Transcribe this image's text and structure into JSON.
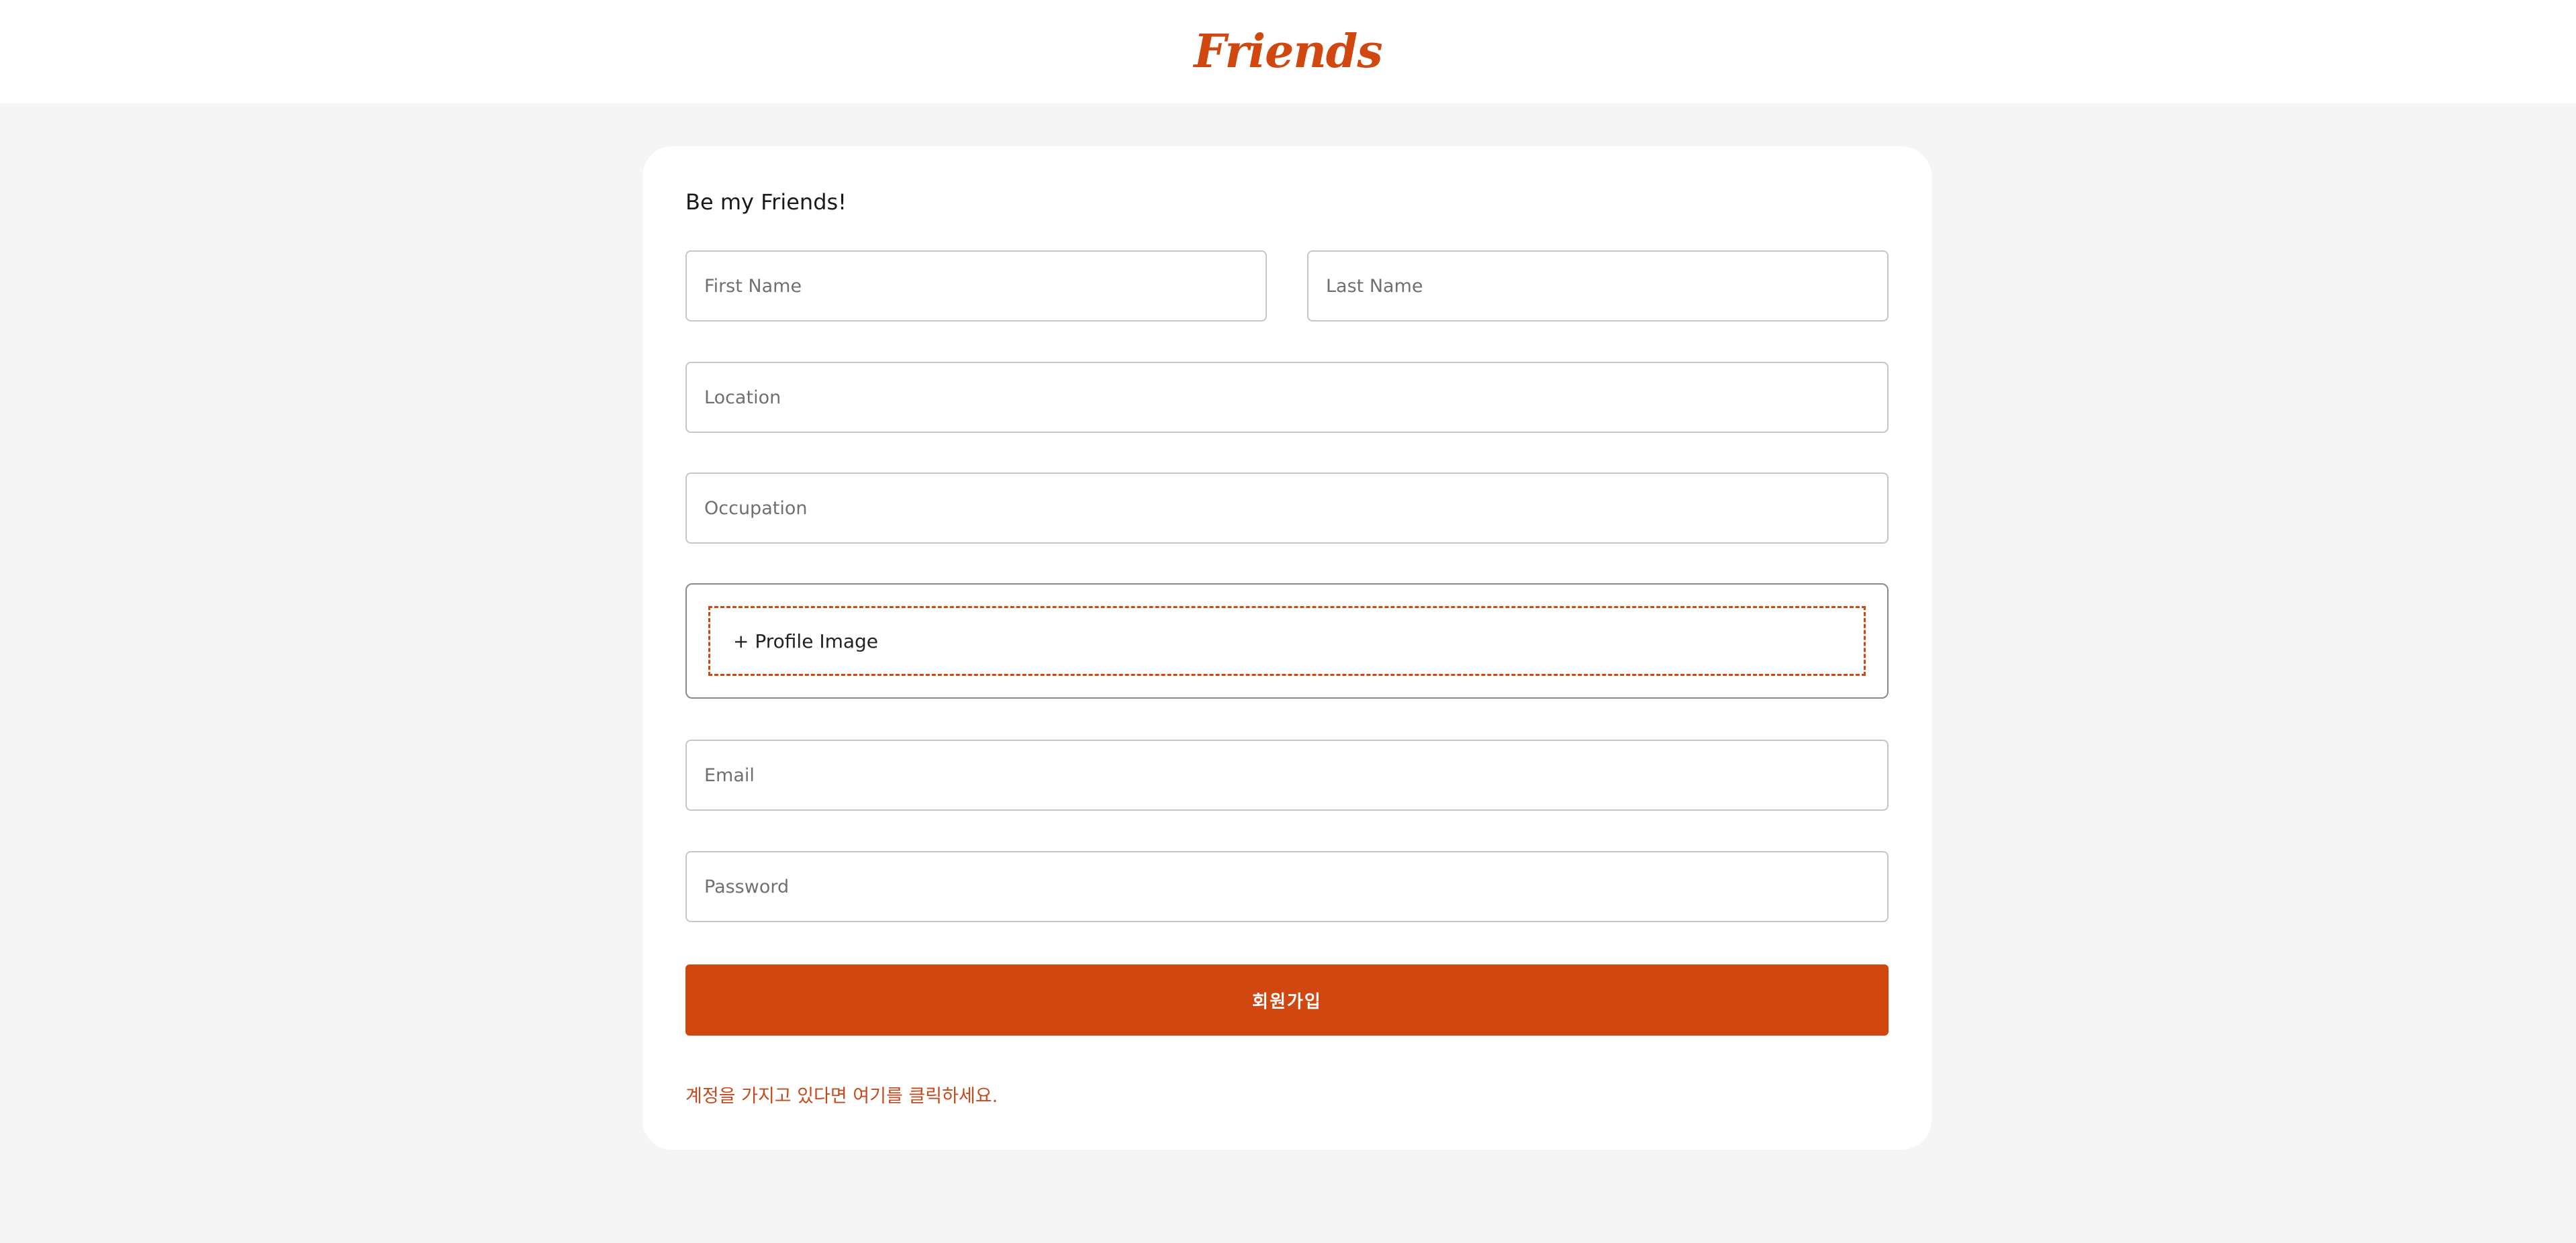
{
  "header": {
    "brand": "Friends"
  },
  "form": {
    "title": "Be my Friends!",
    "first_name_placeholder": "First Name",
    "last_name_placeholder": "Last Name",
    "location_placeholder": "Location",
    "occupation_placeholder": "Occupation",
    "profile_image_label": "+ Profile Image",
    "email_placeholder": "Email",
    "password_placeholder": "Password",
    "submit_label": "회원가입",
    "login_link": "계정을 가지고 있다면 여기를 클릭하세요."
  },
  "colors": {
    "accent": "#d14710",
    "background": "#f5f5f5",
    "card": "#ffffff"
  }
}
